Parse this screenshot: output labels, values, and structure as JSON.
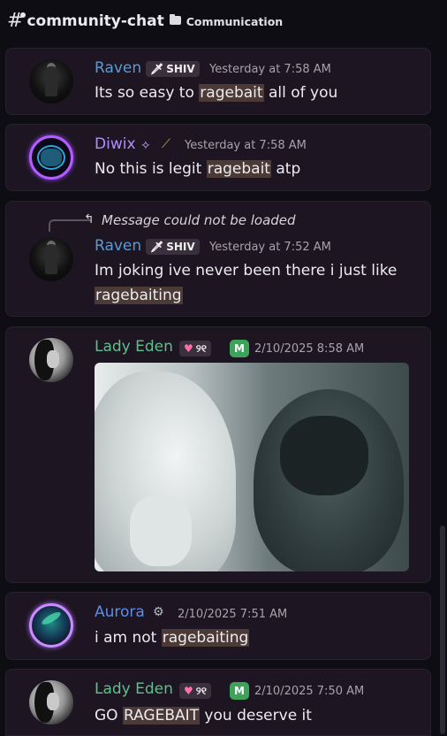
{
  "header": {
    "channel": "community-chat",
    "category": "Communication"
  },
  "messages": [
    {
      "user": "Raven",
      "tag": "SHIV",
      "time": "Yesterday at 7:58 AM",
      "text_before": "Its so easy to ",
      "highlight": "ragebait",
      "text_after": " all of you"
    },
    {
      "user": "Diwix",
      "time": "Yesterday at 7:58 AM",
      "text_before": "No this is legit ",
      "highlight": "ragebait",
      "text_after": " atp"
    },
    {
      "reply": "Message could not be loaded",
      "user": "Raven",
      "tag": "SHIV",
      "time": "Yesterday at 7:52 AM",
      "text_before": "Im joking ive never been there i just like",
      "highlight": "ragebaiting",
      "text_after": ""
    },
    {
      "user": "Lady Eden",
      "tag": "୨୧",
      "guild": "M",
      "time": "2/10/2025 8:58 AM"
    },
    {
      "user": "Aurora",
      "time": "2/10/2025 7:51 AM",
      "text_before": "i am not ",
      "highlight": "ragebaiting",
      "text_after": ""
    },
    {
      "user": "Lady Eden",
      "tag": "୨୧",
      "guild": "M",
      "time": "2/10/2025 7:50 AM",
      "text_before": "GO ",
      "highlight": "RAGEBAIT",
      "text_after": " you deserve it"
    }
  ],
  "colors": {
    "raven": "#5b9bd5",
    "diwix": "#b48cff",
    "eden": "#5fc08a",
    "aurora": "#5b8fe6"
  },
  "icons": [
    "hashtag-bell-icon",
    "folder-icon",
    "sword-icon",
    "sparkle-icon",
    "feather-icon",
    "heart-icon",
    "reply-arrow-icon",
    "gear-icon"
  ]
}
